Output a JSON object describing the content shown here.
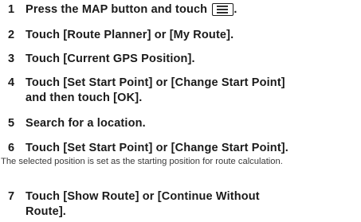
{
  "steps": [
    {
      "num": "1",
      "text": "Press the MAP button and touch",
      "suffix": ".",
      "icon": "menu-icon"
    },
    {
      "num": "2",
      "text": "Touch [Route Planner] or [My Route]."
    },
    {
      "num": "3",
      "text": "Touch [Current GPS Position]."
    },
    {
      "num": "4",
      "text": "Touch [Set Start Point] or [Change Start Point]",
      "text2": "and then touch [OK]."
    },
    {
      "num": "5",
      "text": "Search for a location."
    },
    {
      "num": "6",
      "text": "Touch [Set Start Point] or [Change Start Point].",
      "note": "The selected position is set as the starting position for route calculation."
    },
    {
      "num": "7",
      "text": "Touch [Show Route] or [Continue Without",
      "text2": "Route]."
    }
  ]
}
